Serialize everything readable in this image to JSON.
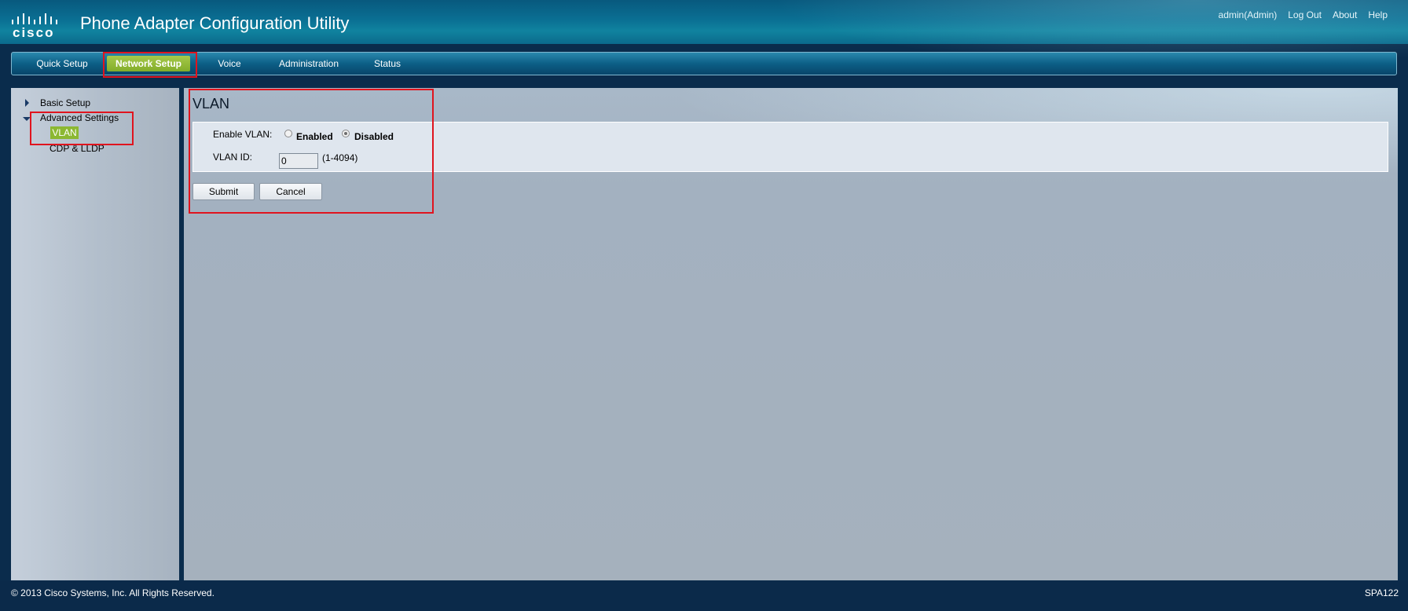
{
  "header": {
    "logo_text": "cisco",
    "app_title": "Phone Adapter Configuration Utility",
    "links": [
      "admin(Admin)",
      "Log Out",
      "About",
      "Help"
    ]
  },
  "tabs": [
    {
      "label": "Quick Setup",
      "active": false
    },
    {
      "label": "Network Setup",
      "active": true
    },
    {
      "label": "Voice",
      "active": false
    },
    {
      "label": "Administration",
      "active": false
    },
    {
      "label": "Status",
      "active": false
    }
  ],
  "sidebar": {
    "items": [
      {
        "label": "Basic Setup",
        "expanded": false
      },
      {
        "label": "Advanced Settings",
        "expanded": true
      },
      {
        "label": "VLAN",
        "selected": true
      },
      {
        "label": "CDP & LLDP",
        "selected": false
      }
    ]
  },
  "content": {
    "title": "VLAN",
    "enable_vlan_label": "Enable VLAN:",
    "enabled_label": "Enabled",
    "disabled_label": "Disabled",
    "selected_option": "Disabled",
    "vlan_id_label": "VLAN ID:",
    "vlan_id_value": "0",
    "vlan_id_range": "(1-4094)",
    "submit_label": "Submit",
    "cancel_label": "Cancel"
  },
  "footer": {
    "copyright": "© 2013 Cisco Systems, Inc. All Rights Reserved.",
    "model": "SPA122"
  },
  "colors": {
    "accent_green": "#8cb832",
    "annotation_red": "#e0141e",
    "header_blue": "#0a6f93",
    "footer_navy": "#0b2a4a"
  }
}
